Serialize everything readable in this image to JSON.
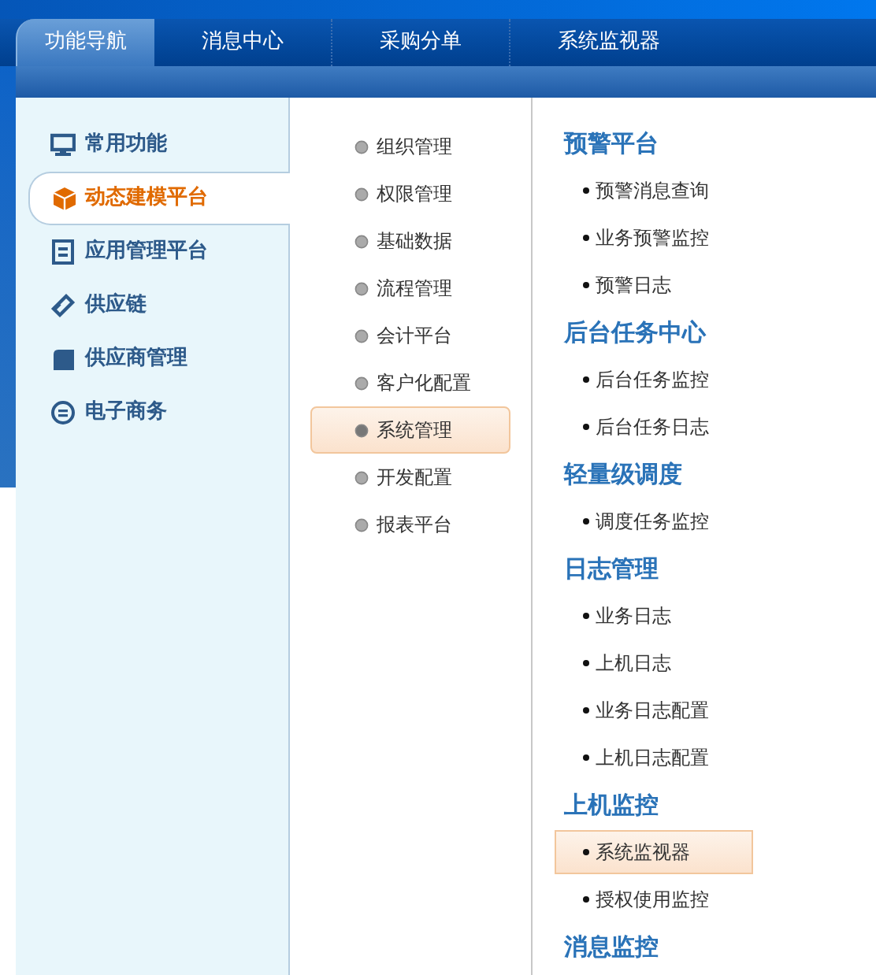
{
  "top_tabs": [
    {
      "label": "功能导航",
      "selected": true
    },
    {
      "label": "消息中心",
      "selected": false
    },
    {
      "label": "采购分单",
      "selected": false
    },
    {
      "label": "系统监视器",
      "selected": false
    }
  ],
  "categories": [
    {
      "label": "常用功能",
      "selected": false,
      "kind": "monitor"
    },
    {
      "label": "动态建模平台",
      "selected": true,
      "kind": "cube"
    },
    {
      "label": "应用管理平台",
      "selected": false,
      "kind": "cabinet"
    },
    {
      "label": "供应链",
      "selected": false,
      "kind": "link"
    },
    {
      "label": "供应商管理",
      "selected": false,
      "kind": "tile"
    },
    {
      "label": "电子商务",
      "selected": false,
      "kind": "circle"
    }
  ],
  "modules": [
    {
      "label": "组织管理",
      "selected": false
    },
    {
      "label": "权限管理",
      "selected": false
    },
    {
      "label": "基础数据",
      "selected": false
    },
    {
      "label": "流程管理",
      "selected": false
    },
    {
      "label": "会计平台",
      "selected": false
    },
    {
      "label": "客户化配置",
      "selected": false
    },
    {
      "label": "系统管理",
      "selected": true
    },
    {
      "label": "开发配置",
      "selected": false
    },
    {
      "label": "报表平台",
      "selected": false
    }
  ],
  "sections": [
    {
      "title": "预警平台",
      "items": [
        {
          "label": "预警消息查询",
          "selected": false
        },
        {
          "label": "业务预警监控",
          "selected": false
        },
        {
          "label": "预警日志",
          "selected": false
        }
      ]
    },
    {
      "title": "后台任务中心",
      "items": [
        {
          "label": "后台任务监控",
          "selected": false
        },
        {
          "label": "后台任务日志",
          "selected": false
        }
      ]
    },
    {
      "title": "轻量级调度",
      "items": [
        {
          "label": "调度任务监控",
          "selected": false
        }
      ]
    },
    {
      "title": "日志管理",
      "items": [
        {
          "label": "业务日志",
          "selected": false
        },
        {
          "label": "上机日志",
          "selected": false
        },
        {
          "label": "业务日志配置",
          "selected": false
        },
        {
          "label": "上机日志配置",
          "selected": false
        }
      ]
    },
    {
      "title": "上机监控",
      "items": [
        {
          "label": "系统监视器",
          "selected": true
        },
        {
          "label": "授权使用监控",
          "selected": false
        }
      ]
    },
    {
      "title": "消息监控"
    }
  ]
}
